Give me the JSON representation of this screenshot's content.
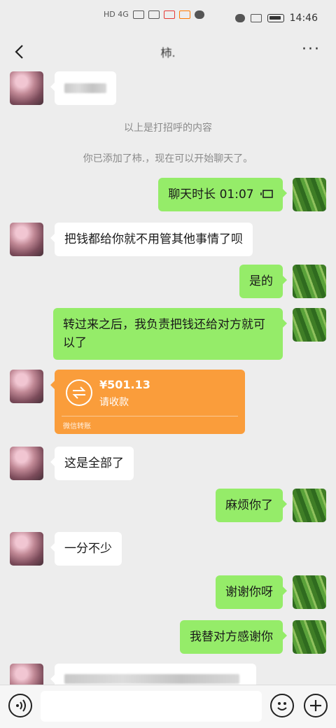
{
  "status_bar": {
    "left_text": "HD 4G",
    "time": "14:46"
  },
  "header": {
    "title": "柿.",
    "back_icon": "chevron-left-icon",
    "more_label": "···"
  },
  "system_messages": {
    "greeting_note": "以上是打招呼的内容",
    "added_note": "你已添加了柿.，现在可以开始聊天了。"
  },
  "messages": [
    {
      "side": "out",
      "text": "聊天时长 01:07"
    },
    {
      "side": "in",
      "text": "把钱都给你就不用管其他事情了呗"
    },
    {
      "side": "out",
      "text": "是的"
    },
    {
      "side": "out",
      "text": "转过来之后，我负责把钱还给对方就可以了"
    },
    {
      "side": "in",
      "text": "这是全部了"
    },
    {
      "side": "out",
      "text": "麻烦你了"
    },
    {
      "side": "in",
      "text": "一分不少"
    },
    {
      "side": "out",
      "text": "谢谢你呀"
    },
    {
      "side": "out",
      "text": "我替对方感谢你"
    }
  ],
  "transfer": {
    "amount": "¥501.13",
    "status": "请收款",
    "footer": "微信转账",
    "color": "#fa9d3b"
  },
  "colors": {
    "outgoing_bubble": "#95ec69",
    "incoming_bubble": "#ffffff",
    "background": "#ededed"
  },
  "input_bar": {
    "voice_icon": "voice-icon",
    "emoji_icon": "emoji-icon",
    "plus_icon": "plus-icon"
  }
}
